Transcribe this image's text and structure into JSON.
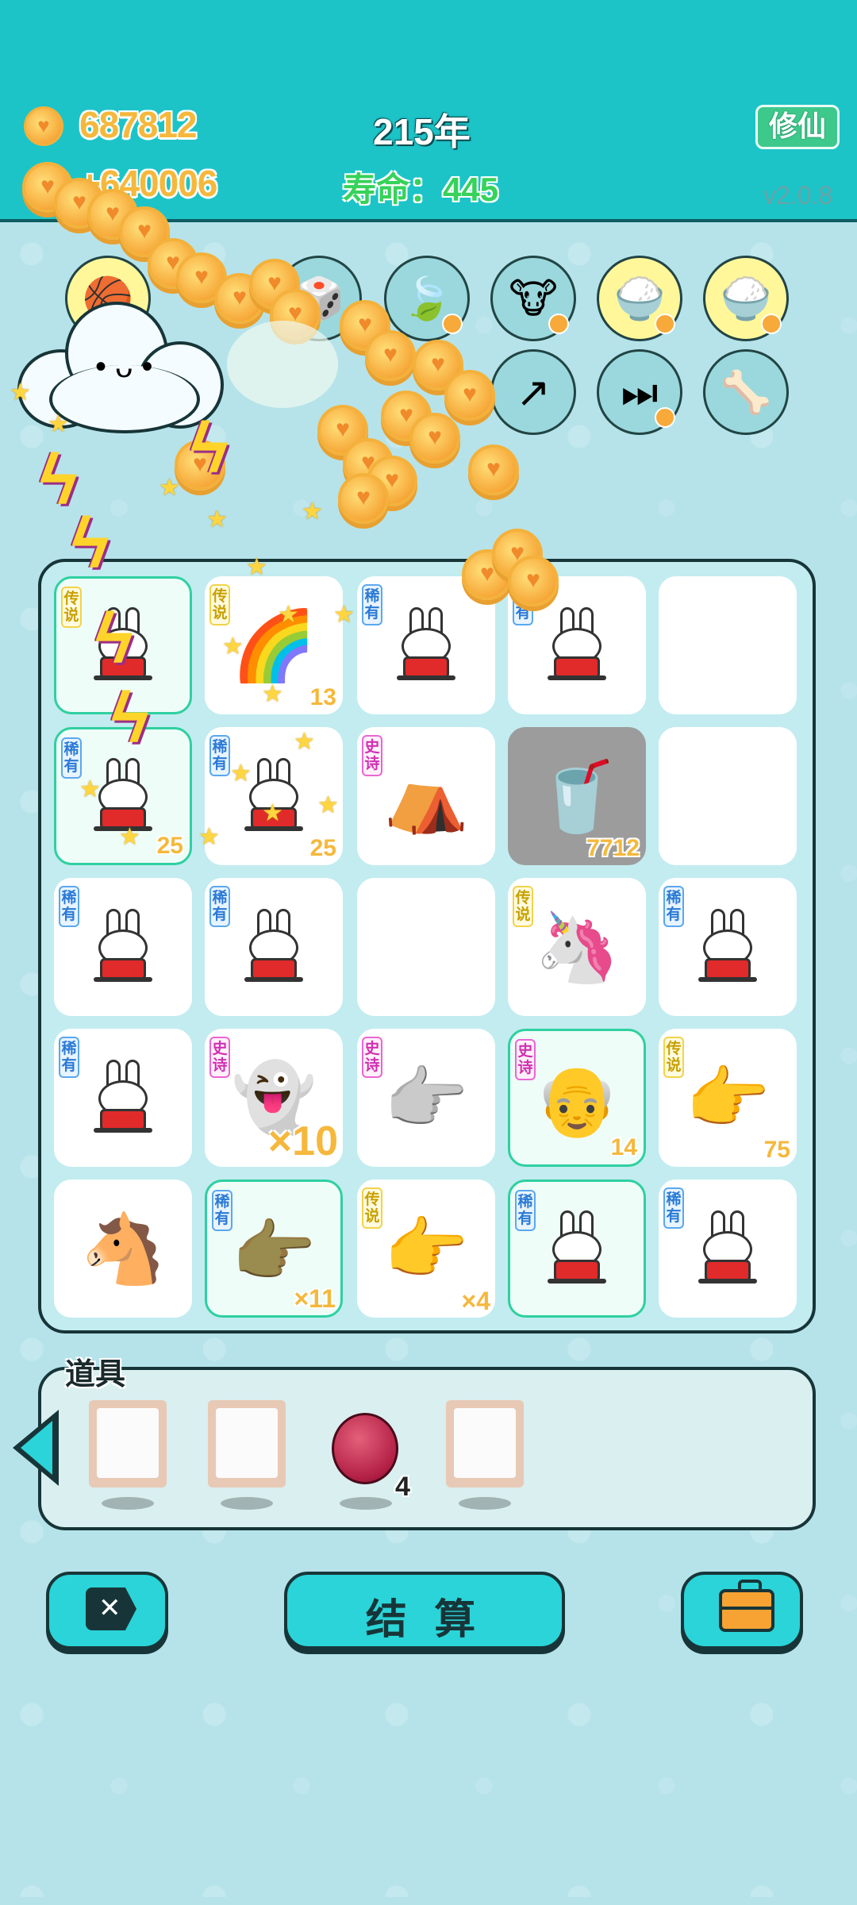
{
  "header": {
    "coins": "687812",
    "income": "+640006",
    "year": "215年",
    "lifespan_label": "寿命：",
    "lifespan_value": "445",
    "cultivate_button": "修仙",
    "version": "v2.0.8"
  },
  "upgrade_icons": [
    {
      "name": "basketball-icon",
      "color": "yellow"
    },
    {
      "name": "dice-icon",
      "color": "blue"
    },
    {
      "name": "leaf-icon",
      "color": "blue"
    },
    {
      "name": "cow-pair-icon",
      "color": "blue"
    },
    {
      "name": "rice-bowl-icon",
      "color": "yellow"
    },
    {
      "name": "rice-bowl-icon",
      "color": "yellow"
    },
    {
      "name": "arrow-up-icon",
      "color": "blue"
    },
    {
      "name": "skip-icon",
      "color": "blue"
    },
    {
      "name": "dog-food-icon",
      "color": "blue"
    }
  ],
  "board": {
    "rarity_labels": {
      "rare": "稀有",
      "legend": "传说",
      "epic": "史诗"
    },
    "cells": [
      {
        "rarity": "legend",
        "item": "rabbit",
        "count": ""
      },
      {
        "rarity": "legend",
        "item": "rainbow",
        "count": "13"
      },
      {
        "rarity": "rare",
        "item": "rabbit",
        "count": ""
      },
      {
        "rarity": "rare",
        "item": "rabbit",
        "count": ""
      },
      {
        "rarity": "",
        "item": "",
        "count": ""
      },
      {
        "rarity": "rare",
        "item": "rabbit",
        "count": "25"
      },
      {
        "rarity": "rare",
        "item": "rabbit",
        "count": "25"
      },
      {
        "rarity": "epic",
        "item": "rabbit-house",
        "count": ""
      },
      {
        "rarity": "",
        "item": "cup",
        "count": "7712"
      },
      {
        "rarity": "",
        "item": "",
        "count": ""
      },
      {
        "rarity": "rare",
        "item": "rabbit",
        "count": ""
      },
      {
        "rarity": "rare",
        "item": "rabbit",
        "count": ""
      },
      {
        "rarity": "",
        "item": "",
        "count": ""
      },
      {
        "rarity": "legend",
        "item": "unicorn",
        "count": ""
      },
      {
        "rarity": "rare",
        "item": "rabbit",
        "count": ""
      },
      {
        "rarity": "rare",
        "item": "rabbit",
        "count": ""
      },
      {
        "rarity": "epic",
        "item": "ghost",
        "count": "×10"
      },
      {
        "rarity": "epic",
        "item": "gray-hand",
        "count": ""
      },
      {
        "rarity": "epic",
        "item": "old-man",
        "count": "14"
      },
      {
        "rarity": "legend",
        "item": "yellow-hand",
        "count": "75"
      },
      {
        "rarity": "",
        "item": "horse",
        "count": ""
      },
      {
        "rarity": "rare",
        "item": "brown-hand",
        "count": "×11"
      },
      {
        "rarity": "legend",
        "item": "yellow-hand",
        "count": "×4"
      },
      {
        "rarity": "rare",
        "item": "rabbit",
        "count": ""
      },
      {
        "rarity": "rare",
        "item": "rabbit",
        "count": ""
      }
    ]
  },
  "tools": {
    "label": "道具",
    "items": [
      {
        "type": "empty-frame",
        "count": ""
      },
      {
        "type": "empty-frame",
        "count": ""
      },
      {
        "type": "lychee",
        "count": "4"
      },
      {
        "type": "empty-frame",
        "count": ""
      }
    ]
  },
  "footer": {
    "settle_button": "结 算"
  },
  "colors": {
    "topbar": "#1cc4c8",
    "background": "#b6e3ea",
    "coin_text": "#f5b83c",
    "lifespan": "#36d25a",
    "outline": "#173538"
  }
}
